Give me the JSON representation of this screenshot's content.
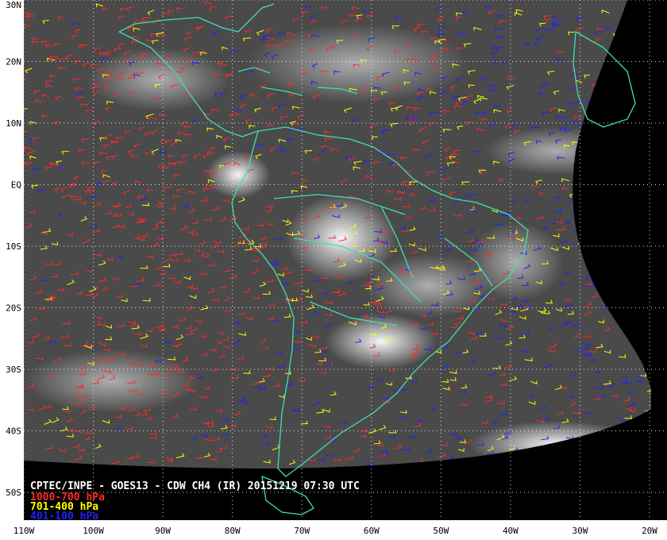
{
  "map": {
    "title": "CPTEC/INPE - GOES13 - CDW CH4 (IR) 20151219 07:30 UTC",
    "latitude_labels": [
      "30N",
      "20N",
      "10N",
      "EQ",
      "10S",
      "20S",
      "30S",
      "40S",
      "50S"
    ],
    "latitudes": [
      30,
      20,
      10,
      0,
      -10,
      -20,
      -30,
      -40,
      -50
    ],
    "longitude_labels": [
      "110W",
      "100W",
      "90W",
      "80W",
      "70W",
      "60W",
      "50W",
      "40W",
      "30W",
      "20W"
    ],
    "longitudes": [
      -110,
      -100,
      -90,
      -80,
      -70,
      -60,
      -50,
      -40,
      -30,
      -20
    ],
    "legend": [
      {
        "label": "1000-700 hPa",
        "color": "#ff2a2a"
      },
      {
        "label": "701-400 hPa",
        "color": "#ffff00"
      },
      {
        "label": "401-100 hPa",
        "color": "#2020ff"
      }
    ],
    "colors": {
      "coastline": "#40e0b0",
      "grid": "#ffffff",
      "background": "#000000",
      "frame_background": "#ffffff"
    }
  }
}
